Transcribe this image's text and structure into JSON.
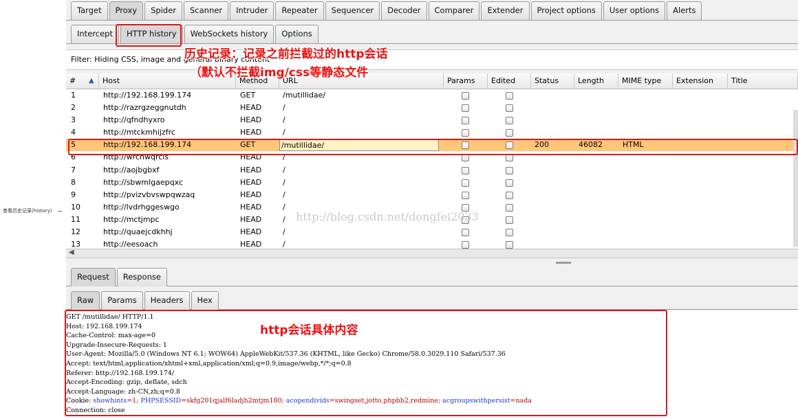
{
  "outside_label": "查看历史记录(history)",
  "main_tabs": [
    "Target",
    "Proxy",
    "Spider",
    "Scanner",
    "Intruder",
    "Repeater",
    "Sequencer",
    "Decoder",
    "Comparer",
    "Extender",
    "Project options",
    "User options",
    "Alerts"
  ],
  "proxy_tabs": [
    "Intercept",
    "HTTP history",
    "WebSockets history",
    "Options"
  ],
  "filter_text": "Filter: Hiding CSS, image and general binary content",
  "columns": [
    "#",
    "Host",
    "Method",
    "URL",
    "Params",
    "Edited",
    "Status",
    "Length",
    "MIME type",
    "Extension",
    "Title"
  ],
  "rows": [
    {
      "num": "1",
      "host": "http://192.168.199.174",
      "method": "GET",
      "url": "/mutillidae/",
      "status": "",
      "length": "",
      "mime": ""
    },
    {
      "num": "2",
      "host": "http://razrgzeggnutdh",
      "method": "HEAD",
      "url": "/",
      "status": "",
      "length": "",
      "mime": ""
    },
    {
      "num": "3",
      "host": "http://qfndhyxro",
      "method": "HEAD",
      "url": "/",
      "status": "",
      "length": "",
      "mime": ""
    },
    {
      "num": "4",
      "host": "http://mtckmhijzfrc",
      "method": "HEAD",
      "url": "/",
      "status": "",
      "length": "",
      "mime": ""
    },
    {
      "num": "5",
      "host": "http://192.168.199.174",
      "method": "GET",
      "url": "/mutillidae/",
      "status": "200",
      "length": "46082",
      "mime": "HTML"
    },
    {
      "num": "6",
      "host": "http://wrchwqrcis",
      "method": "HEAD",
      "url": "/",
      "status": "",
      "length": "",
      "mime": ""
    },
    {
      "num": "7",
      "host": "http://aojbgbxf",
      "method": "HEAD",
      "url": "/",
      "status": "",
      "length": "",
      "mime": ""
    },
    {
      "num": "8",
      "host": "http://sbwmlgaepqxc",
      "method": "HEAD",
      "url": "/",
      "status": "",
      "length": "",
      "mime": ""
    },
    {
      "num": "9",
      "host": "http://pvizvbvswpqwzaq",
      "method": "HEAD",
      "url": "/",
      "status": "",
      "length": "",
      "mime": ""
    },
    {
      "num": "10",
      "host": "http://lvdrhggeswgo",
      "method": "HEAD",
      "url": "/",
      "status": "",
      "length": "",
      "mime": ""
    },
    {
      "num": "11",
      "host": "http://mctjmpc",
      "method": "HEAD",
      "url": "/",
      "status": "",
      "length": "",
      "mime": ""
    },
    {
      "num": "12",
      "host": "http://quaejcdkhhj",
      "method": "HEAD",
      "url": "/",
      "status": "",
      "length": "",
      "mime": ""
    },
    {
      "num": "13",
      "host": "http://eesoach",
      "method": "HEAD",
      "url": "/",
      "status": "",
      "length": "",
      "mime": ""
    }
  ],
  "selected_row": 5,
  "message_tabs": [
    "Request",
    "Response"
  ],
  "view_tabs": [
    "Raw",
    "Params",
    "Headers",
    "Hex"
  ],
  "request_lines": [
    "GET /mutillidae/ HTTP/1.1",
    "Host: 192.168.199.174",
    "Cache-Control: max-age=0",
    "Upgrade-Insecure-Requests: 1",
    "User-Agent: Mozilla/5.0 (Windows NT 6.1; WOW64) AppleWebKit/537.36 (KHTML, like Gecko) Chrome/58.0.3029.110 Safari/537.36",
    "Accept: text/html,application/xhtml+xml,application/xml;q=0.9,image/webp,*/*;q=0.8",
    "Referer: http://192.168.199.174/",
    "Accept-Encoding: gzip, deflate, sdch",
    "Accept-Language: zh-CN,zh;q=0.8"
  ],
  "cookie_line": {
    "prefix": "Cookie: ",
    "k1": "showhints",
    "v1": "=1; ",
    "k2": "PHPSESSID",
    "v2": "=skfg201qjalf6ladjh2mtjm180; ",
    "k3": "acopendivids",
    "v3": "=swingset,jotto,phpbb2,redmine; ",
    "k4": "acgroupswithpersist",
    "v4": "=nada"
  },
  "last_line": "Connection: close",
  "annotations": {
    "history_line1": "历史记录：记录之前拦截过的http会话",
    "history_line2": "（默认不拦截img/css等静态文件",
    "session_label": "http会话具体内容"
  },
  "watermark": "http://blog.csdn.net/dongfei2033"
}
